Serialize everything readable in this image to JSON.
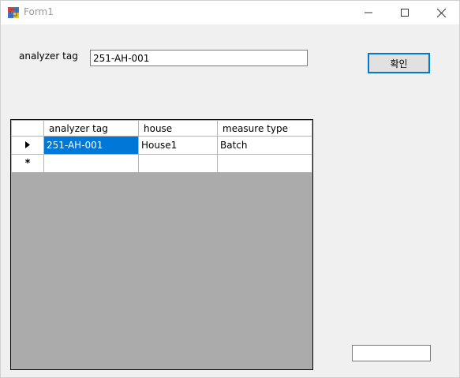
{
  "window": {
    "title": "Form1",
    "icons": {
      "app": "winforms-app-icon",
      "minimize": "minimize-icon",
      "maximize": "maximize-icon",
      "close": "close-icon"
    }
  },
  "form": {
    "label": "analyzer tag",
    "input_value": "251-AH-001",
    "confirm_label": "확인",
    "small_input_value": ""
  },
  "grid": {
    "columns": [
      "analyzer tag",
      "house",
      "measure type"
    ],
    "rows": [
      {
        "indicator": "current-row-arrow-icon",
        "cells": [
          "251-AH-001",
          "House1",
          "Batch"
        ]
      },
      {
        "indicator": "new-row-asterisk-icon",
        "cells": [
          "",
          "",
          ""
        ]
      }
    ],
    "new_row_glyph": "*",
    "selection_color": "#0078d7",
    "background_color": "#ababab"
  }
}
